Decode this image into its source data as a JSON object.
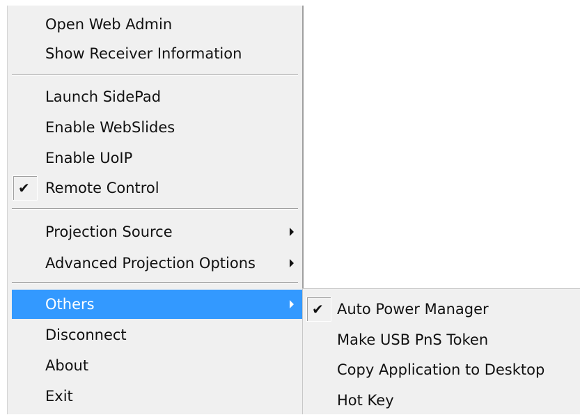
{
  "main_menu": {
    "items": [
      {
        "label": "Open Web Admin"
      },
      {
        "label": "Show Receiver Information"
      },
      {
        "label": "Launch SidePad"
      },
      {
        "label": "Enable WebSlides"
      },
      {
        "label": "Enable UoIP"
      },
      {
        "label": "Remote Control",
        "checked": true
      },
      {
        "label": "Projection Source",
        "submenu": true
      },
      {
        "label": "Advanced Projection Options",
        "submenu": true
      },
      {
        "label": "Others",
        "submenu": true,
        "highlighted": true
      },
      {
        "label": "Disconnect"
      },
      {
        "label": "About"
      },
      {
        "label": "Exit"
      }
    ]
  },
  "sub_menu": {
    "items": [
      {
        "label": "Auto Power Manager",
        "checked": true
      },
      {
        "label": "Make USB PnS Token"
      },
      {
        "label": "Copy Application to Desktop"
      },
      {
        "label": "Hot Key"
      }
    ]
  },
  "icons": {
    "check": "check-mark-icon",
    "submenu_arrow": "submenu-arrow-icon"
  },
  "colors": {
    "menu_background": "#f0f0f0",
    "highlight": "#3399ff",
    "highlight_text": "#ffffff",
    "text": "#111111"
  }
}
